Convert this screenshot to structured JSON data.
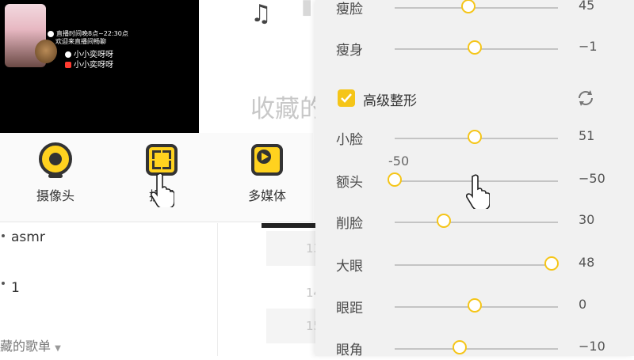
{
  "stream_overlay": {
    "line1": "直播时间晚8点~22:30点",
    "line2": "欢迎来直播间畅聊",
    "handle_douyin": "小小奕呀呀",
    "handle_xhs": "小小奕呀呀"
  },
  "toolbar": {
    "items": [
      {
        "label": "摄像头",
        "icon": "webcam-icon"
      },
      {
        "label": "投屏",
        "icon": "screen-capture-icon"
      },
      {
        "label": "多媒体",
        "icon": "multimedia-play-icon"
      }
    ]
  },
  "left_list": {
    "items": [
      "asmr",
      "1"
    ],
    "footer": "藏的歌单"
  },
  "background": {
    "title": "收藏的",
    "numbers": [
      "13",
      "14",
      "15"
    ]
  },
  "beauty_panel": {
    "basic": [
      {
        "label": "瘦脸",
        "value": "45",
        "fraction": 0.45
      },
      {
        "label": "瘦身",
        "value": "−1",
        "fraction": 0.49
      }
    ],
    "advanced_title": "高级整形",
    "advanced_checked": true,
    "advanced": [
      {
        "label": "小脸",
        "value": "51",
        "fraction": 0.49
      },
      {
        "label": "额头",
        "value": "−50",
        "fraction": 0.0
      },
      {
        "label": "削脸",
        "value": "30",
        "fraction": 0.3
      },
      {
        "label": "大眼",
        "value": "48",
        "fraction": 0.96
      },
      {
        "label": "眼距",
        "value": "0",
        "fraction": 0.49
      },
      {
        "label": "眼角",
        "value": "−10",
        "fraction": 0.4
      }
    ],
    "drag_tooltip": "-50"
  },
  "colors": {
    "accent": "#f5c518",
    "panel_bg": "#f1f1f1",
    "icon_dark": "#333333"
  }
}
